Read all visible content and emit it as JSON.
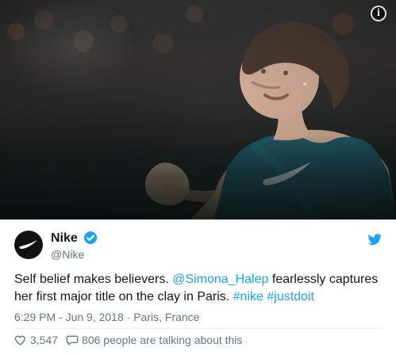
{
  "media": {
    "info_icon": "info-icon"
  },
  "tweet": {
    "author": {
      "name": "Nike",
      "handle": "@Nike",
      "verified": true,
      "avatar_icon": "nike-swoosh-icon"
    },
    "platform_icon": "twitter-bird-icon",
    "text": {
      "part1": "Self belief makes believers. ",
      "mention": "@Simona_Halep",
      "part2": " fearlessly captures her first major title on the clay in Paris. ",
      "hashtag1": "#nike",
      "space": " ",
      "hashtag2": "#justdoit"
    },
    "meta": {
      "time": "6:29 PM - Jun 9, 2018",
      "separator": " · ",
      "location": "Paris, France"
    },
    "actions": {
      "likes": "3,547",
      "talking": "806 people are talking about this"
    }
  },
  "colors": {
    "link": "#1da1f2",
    "secondary_text": "#657786",
    "primary_text": "#14171a",
    "divider": "#e6ecf0"
  }
}
